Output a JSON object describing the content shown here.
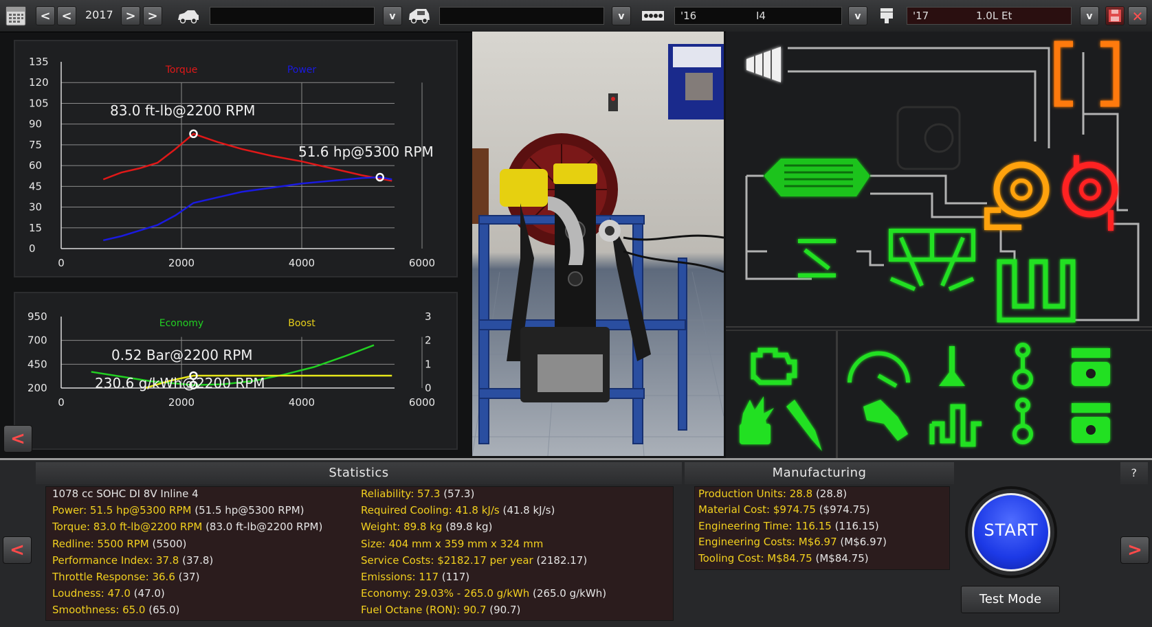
{
  "topbar": {
    "year": "2017",
    "car_field": "",
    "trim_field": "",
    "family_year": "'16",
    "family_name": "I4",
    "variant_year": "'17",
    "variant_name": "1.0L Et"
  },
  "chart_data": [
    {
      "type": "line",
      "title": "",
      "legend": [
        "Torque",
        "Power"
      ],
      "x_ticks": [
        "0",
        "2000",
        "4000",
        "6000"
      ],
      "y_ticks": [
        "0",
        "15",
        "30",
        "45",
        "60",
        "75",
        "90",
        "105",
        "120",
        "135"
      ],
      "xlim": [
        0,
        6000
      ],
      "ylim": [
        0,
        135
      ],
      "grid": true,
      "series": [
        {
          "name": "Torque",
          "color": "#e01818",
          "x": [
            700,
            1000,
            1300,
            1600,
            1900,
            2200,
            2600,
            3000,
            3500,
            4000,
            4500,
            5000,
            5500
          ],
          "y": [
            50,
            55,
            58,
            62,
            72,
            83,
            77,
            72,
            67,
            63,
            58,
            53,
            49
          ]
        },
        {
          "name": "Power",
          "color": "#1a1ae0",
          "x": [
            700,
            1000,
            1300,
            1600,
            1900,
            2200,
            2600,
            3000,
            3500,
            4000,
            4500,
            5000,
            5300,
            5500
          ],
          "y": [
            6,
            9,
            13,
            17,
            24,
            33,
            37,
            41,
            44,
            47,
            49,
            51,
            51.6,
            50
          ]
        }
      ],
      "annotations": [
        "83.0 ft-lb@2200 RPM",
        "51.6 hp@5300 RPM"
      ]
    },
    {
      "type": "line",
      "title": "",
      "legend": [
        "Economy",
        "Boost"
      ],
      "x_ticks": [
        "0",
        "2000",
        "4000",
        "6000"
      ],
      "y_ticks_left": [
        "200",
        "450",
        "700",
        "950"
      ],
      "y_ticks_right": [
        "0",
        "1",
        "2",
        "3"
      ],
      "xlim": [
        0,
        6000
      ],
      "ylim_left": [
        200,
        950
      ],
      "ylim_right": [
        0,
        3
      ],
      "grid": true,
      "series": [
        {
          "name": "Economy",
          "color": "#22d022",
          "axis": "left",
          "x": [
            500,
            1000,
            1500,
            2200,
            2700,
            3200,
            3700,
            4200,
            4700,
            5200
          ],
          "y": [
            370,
            320,
            270,
            231,
            240,
            275,
            340,
            420,
            530,
            650
          ]
        },
        {
          "name": "Boost",
          "color": "#e8e81a",
          "axis": "right",
          "x": [
            1400,
            1800,
            2200,
            3000,
            4000,
            5000,
            5500
          ],
          "y": [
            0,
            0.3,
            0.52,
            0.52,
            0.52,
            0.52,
            0.52
          ]
        }
      ],
      "annotations": [
        "0.52 Bar@2200 RPM",
        "230.6 g/kWh@2200 RPM"
      ]
    }
  ],
  "statistics": {
    "heading": "Statistics",
    "left": [
      {
        "label": "1078 cc SOHC DI 8V Inline 4",
        "value": ""
      },
      {
        "label": "Power: 51.5 hp@5300 RPM",
        "value": "(51.5 hp@5300 RPM)"
      },
      {
        "label": "Torque: 83.0 ft-lb@2200 RPM",
        "value": "(83.0 ft-lb@2200 RPM)"
      },
      {
        "label": "Redline: 5500 RPM",
        "value": "(5500)"
      },
      {
        "label": "Performance Index: 37.8",
        "value": "(37.8)"
      },
      {
        "label": "Throttle Response: 36.6",
        "value": "(37)"
      },
      {
        "label": "Loudness: 47.0",
        "value": "(47.0)"
      },
      {
        "label": "Smoothness: 65.0",
        "value": "(65.0)"
      }
    ],
    "right": [
      {
        "label": "Reliability: 57.3",
        "value": "(57.3)"
      },
      {
        "label": "Required Cooling: 41.8 kJ/s",
        "value": "(41.8 kJ/s)"
      },
      {
        "label": "Weight: 89.8 kg",
        "value": "(89.8 kg)"
      },
      {
        "label": "Size: 404 mm x 359 mm x 324 mm",
        "value": ""
      },
      {
        "label": "Service Costs: $2182.17 per year",
        "value": "(2182.17)"
      },
      {
        "label": "Emissions: 117",
        "value": "(117)"
      },
      {
        "label": "Economy: 29.03% - 265.0 g/kWh",
        "value": "(265.0 g/kWh)"
      },
      {
        "label": "Fuel Octane (RON): 90.7",
        "value": "(90.7)"
      }
    ]
  },
  "manufacturing": {
    "heading": "Manufacturing",
    "rows": [
      {
        "label": "Production Units: 28.8",
        "value": "(28.8)"
      },
      {
        "label": "Material Cost: $974.75",
        "value": "($974.75)"
      },
      {
        "label": "Engineering Time: 116.15",
        "value": "(116.15)"
      },
      {
        "label": "Engineering Costs: M$6.97",
        "value": "(M$6.97)"
      },
      {
        "label": "Tooling Cost: M$84.75",
        "value": "(M$84.75)"
      }
    ]
  },
  "controls": {
    "start_label": "START",
    "test_mode_label": "Test Mode",
    "help_label": "?",
    "prev_glyph": "<",
    "next_glyph": ">"
  },
  "colors": {
    "glow_green": "#2cff2c",
    "turbo_orange": "#ffa20a",
    "turbo_red": "#ff2020",
    "stat_label": "#f2d01f",
    "start_blue": "#1c39e6"
  }
}
